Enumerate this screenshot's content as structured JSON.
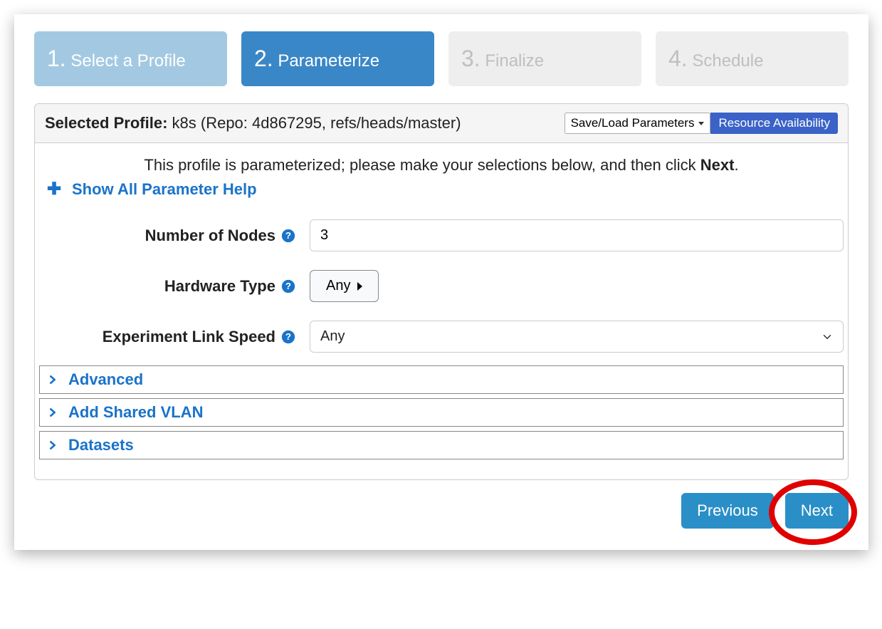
{
  "steps": [
    {
      "num": "1.",
      "label": "Select a Profile",
      "state": "completed"
    },
    {
      "num": "2.",
      "label": "Parameterize",
      "state": "active"
    },
    {
      "num": "3.",
      "label": "Finalize",
      "state": "future"
    },
    {
      "num": "4.",
      "label": "Schedule",
      "state": "future"
    }
  ],
  "header": {
    "label": "Selected Profile:",
    "profile": "k8s (Repo: 4d867295, refs/heads/master)",
    "saveload": "Save/Load Parameters",
    "resource": "Resource Availability"
  },
  "intro": {
    "text_a": "This profile is parameterized; please make your selections below, and then click ",
    "text_b": "Next",
    "text_c": "."
  },
  "show_help": "Show All Parameter Help",
  "fields": {
    "num_nodes": {
      "label": "Number of Nodes",
      "value": "3"
    },
    "hw_type": {
      "label": "Hardware Type",
      "value": "Any"
    },
    "link_speed": {
      "label": "Experiment Link Speed",
      "value": "Any"
    }
  },
  "groups": {
    "advanced": "Advanced",
    "vlan": "Add Shared VLAN",
    "datasets": "Datasets"
  },
  "buttons": {
    "previous": "Previous",
    "next": "Next"
  }
}
